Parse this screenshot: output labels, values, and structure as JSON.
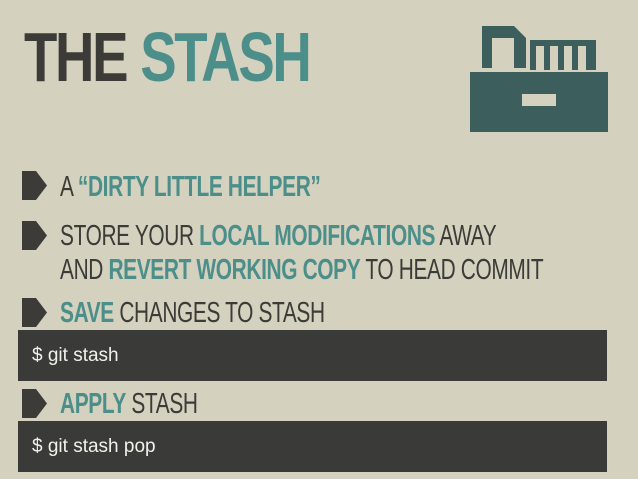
{
  "slide": {
    "title": {
      "word1": "THE",
      "word2": "STASH"
    },
    "bullets": [
      {
        "pre": "A ",
        "highlight": "“DIRTY LITTLE HELPER”",
        "post": ""
      },
      {
        "pre": "STORE YOUR ",
        "highlight": "LOCAL MODIFICATIONS",
        "post": " AWAY"
      },
      {
        "pre": "AND ",
        "highlight": "REVERT WORKING COPY",
        "post": " TO HEAD COMMIT"
      },
      {
        "pre": "",
        "highlight": "SAVE",
        "post": " CHANGES TO STASH"
      },
      {
        "pre": "",
        "highlight": "APPLY",
        "post": " STASH"
      }
    ],
    "commands": [
      "$ git stash",
      "$ git stash pop"
    ],
    "icons": {
      "logo": "stash-box-icon",
      "bullet": "bullet-arrow-icon"
    },
    "colors": {
      "background": "#d4d1be",
      "dark": "#3c3b37",
      "accent": "#4b8e8a",
      "code_bg": "#3a3a38",
      "code_text": "#f2f1ea"
    }
  }
}
